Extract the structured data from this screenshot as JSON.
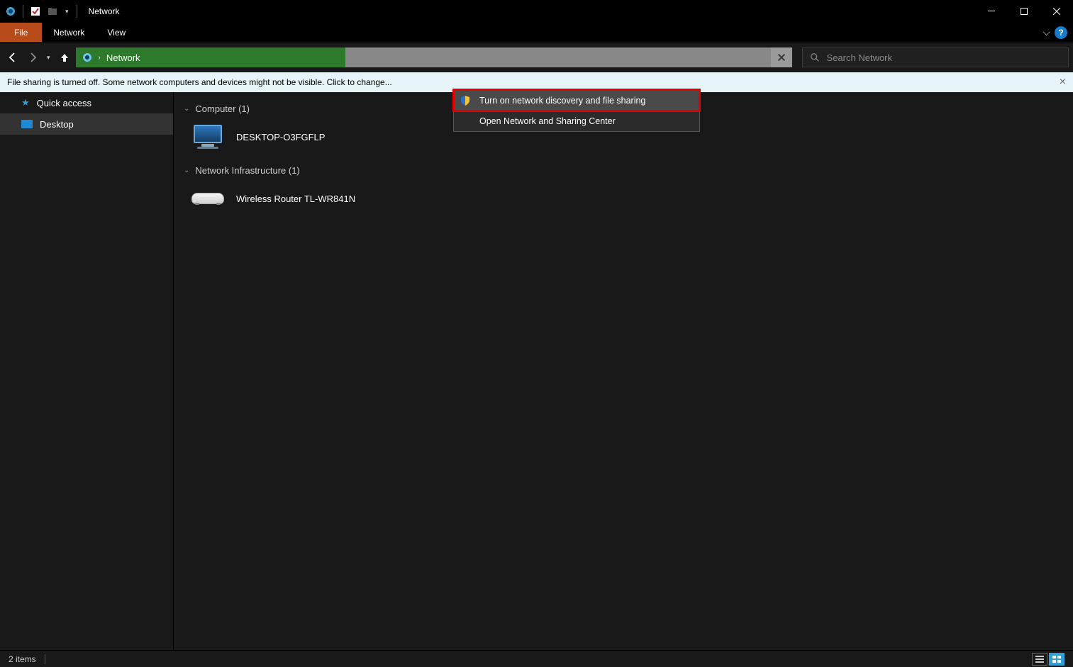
{
  "window": {
    "title": "Network"
  },
  "ribbon": {
    "tabs": {
      "file": "File",
      "network": "Network",
      "view": "View"
    }
  },
  "nav": {
    "address": {
      "crumb": "Network"
    },
    "search": {
      "placeholder": "Search Network"
    }
  },
  "infobar": {
    "message": "File sharing is turned off. Some network computers and devices might not be visible. Click to change..."
  },
  "context_menu": {
    "items": [
      {
        "label": "Turn on network discovery and file sharing",
        "shield": true,
        "highlighted": true
      },
      {
        "label": "Open Network and Sharing Center",
        "shield": false,
        "highlighted": false
      }
    ]
  },
  "sidebar": {
    "items": [
      {
        "label": "Quick access",
        "icon": "star"
      },
      {
        "label": "Desktop",
        "icon": "desktop",
        "selected": true
      }
    ]
  },
  "content": {
    "groups": [
      {
        "header": "Computer (1)",
        "items": [
          {
            "label": "DESKTOP-O3FGFLP",
            "icon": "computer"
          }
        ]
      },
      {
        "header": "Network Infrastructure (1)",
        "items": [
          {
            "label": "Wireless Router TL-WR841N",
            "icon": "router"
          }
        ]
      }
    ]
  },
  "statusbar": {
    "item_count": "2 items"
  }
}
